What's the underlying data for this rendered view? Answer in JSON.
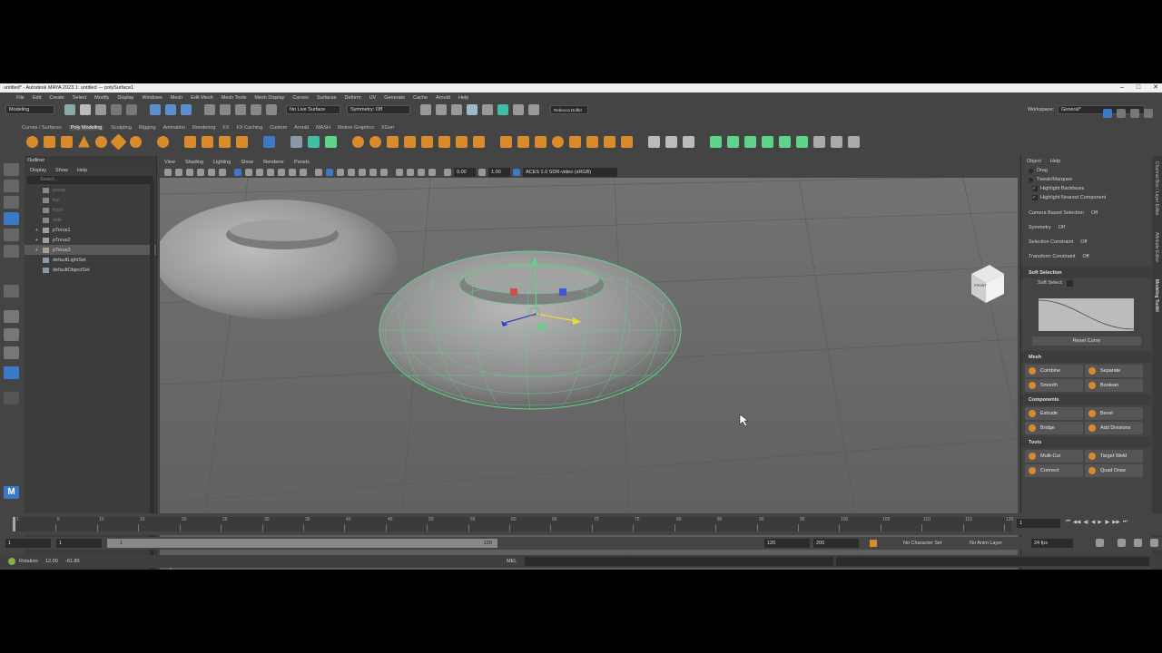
{
  "window": {
    "title": "untitled* - Autodesk MAYA 2023.1: untitled  ---  polySurface1"
  },
  "menus": [
    "File",
    "Edit",
    "Create",
    "Select",
    "Modify",
    "Display",
    "Windows",
    "Mesh",
    "Edit Mesh",
    "Mesh Tools",
    "Mesh Display",
    "Curves",
    "Surfaces",
    "Deform",
    "UV",
    "Generate",
    "Cache",
    "Arnold",
    "Help"
  ],
  "statusline": {
    "mode": "Modeling",
    "live_surface": "No Live Surface",
    "symmetry": "Symmetry: Off",
    "user": "Rebecca Duffer",
    "workspace_label": "Workspace:",
    "workspace": "General*"
  },
  "shelf_tabs": [
    "Curves / Surfaces",
    "Poly Modeling",
    "Sculpting",
    "Rigging",
    "Animation",
    "Rendering",
    "FX",
    "FX Caching",
    "Custom",
    "Arnold",
    "MASH",
    "Motion Graphics",
    "XGen"
  ],
  "shelf_active_tab": "Poly Modeling",
  "outliner": {
    "title": "Outliner",
    "menus": [
      "Display",
      "Show",
      "Help"
    ],
    "search_placeholder": "Search...",
    "items": [
      {
        "label": "persp",
        "dim": true
      },
      {
        "label": "top",
        "dim": true
      },
      {
        "label": "front",
        "dim": true
      },
      {
        "label": "side",
        "dim": true
      },
      {
        "label": "pTorus1",
        "dim": false
      },
      {
        "label": "pTorus2",
        "dim": false
      },
      {
        "label": "pTorus3",
        "dim": false,
        "selected": true
      },
      {
        "label": "defaultLightSet",
        "dim": false
      },
      {
        "label": "defaultObjectSet",
        "dim": false
      }
    ]
  },
  "viewport": {
    "menus": [
      "View",
      "Shading",
      "Lighting",
      "Show",
      "Renderer",
      "Panels"
    ],
    "exposure": "0.00",
    "gamma": "1.00",
    "colorspace": "ACES 1.0 SDR-video (sRGB)",
    "viewcube": "FRONT"
  },
  "modeling_toolkit": {
    "menus": [
      "Object",
      "Help"
    ],
    "options": [
      "Drag",
      "Tweak/Marquee"
    ],
    "checks": [
      "Highlight Backfaces",
      "Highlight Nearest Component"
    ],
    "settings": [
      {
        "label": "Camera Based Selection",
        "value": "Off"
      },
      {
        "label": "Symmetry",
        "value": "Off"
      },
      {
        "label": "Selection Constraint",
        "value": "Off"
      },
      {
        "label": "Transform Constraint",
        "value": "Off"
      }
    ],
    "soft_selection": {
      "title": "Soft Selection",
      "label": "Soft Select:",
      "reset": "Reset Curve"
    },
    "sections": [
      {
        "title": "Mesh",
        "buttons": [
          "Combine",
          "Separate",
          "Smooth",
          "Boolean"
        ]
      },
      {
        "title": "Components",
        "buttons": [
          "Extrude",
          "Bevel",
          "Bridge",
          "Add Divisions"
        ]
      },
      {
        "title": "Tools",
        "buttons": [
          "Multi-Cut",
          "Target Weld",
          "Connect",
          "Quad Draw"
        ]
      }
    ]
  },
  "side_tabs": [
    "Channel Box / Layer Editor",
    "Attribute Editor",
    "Modeling Toolkit"
  ],
  "timeline": {
    "ticks": [
      "1",
      "5",
      "10",
      "15",
      "20",
      "25",
      "30",
      "35",
      "40",
      "45",
      "50",
      "55",
      "60",
      "65",
      "70",
      "75",
      "80",
      "85",
      "90",
      "95",
      "100",
      "105",
      "110",
      "115",
      "120"
    ],
    "current_frame": "1"
  },
  "range": {
    "start": "1",
    "start2": "1",
    "slider_start": "1",
    "slider_end": "120",
    "end": "120",
    "end2": "200",
    "character_set": "No Character Set",
    "anim_layer": "No Anim Layer",
    "fps": "24 fps"
  },
  "command": {
    "rotation_label": "Rotation:",
    "rotation_x": "12.00",
    "rotation_y": "-61.80",
    "lang": "MEL"
  },
  "colors": {
    "orange": "#d98a2b",
    "teal": "#3fbfa6",
    "green": "#5fd38a",
    "accent_blue": "#3b7ac7"
  }
}
